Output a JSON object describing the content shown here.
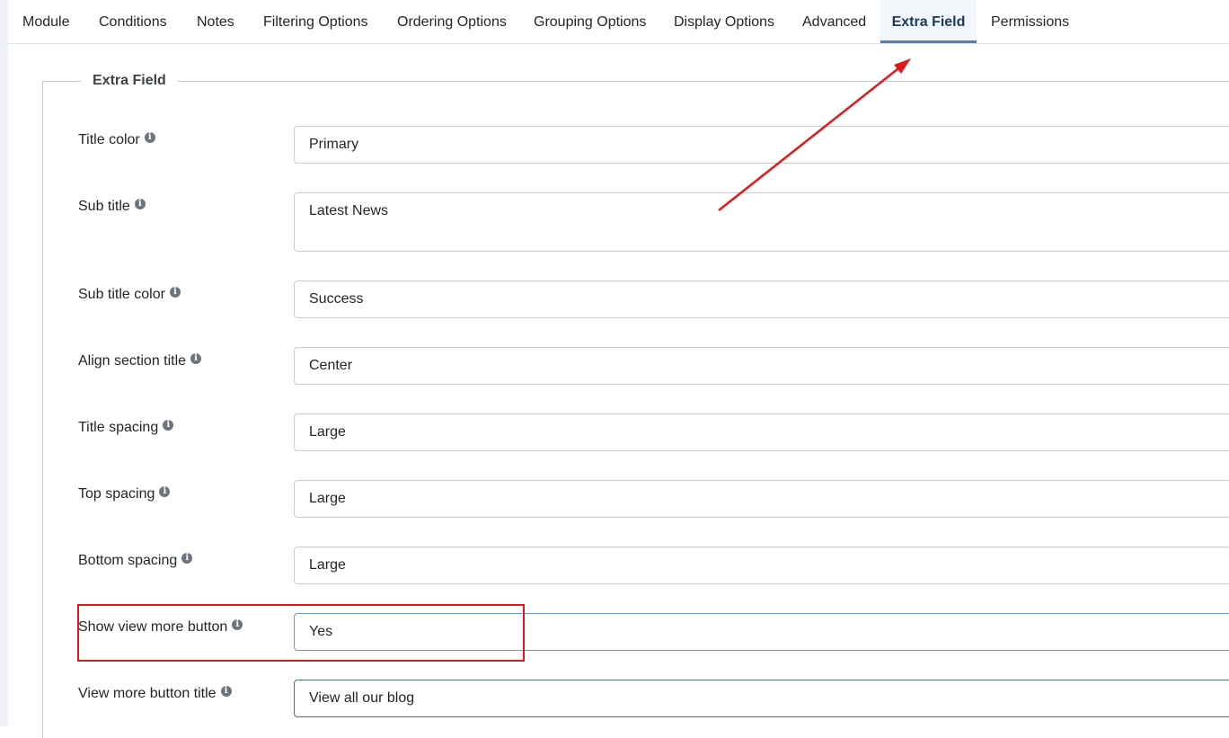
{
  "tabs": [
    {
      "label": "Module"
    },
    {
      "label": "Conditions"
    },
    {
      "label": "Notes"
    },
    {
      "label": "Filtering Options"
    },
    {
      "label": "Ordering Options"
    },
    {
      "label": "Grouping Options"
    },
    {
      "label": "Display Options"
    },
    {
      "label": "Advanced"
    },
    {
      "label": "Extra Field",
      "active": true
    },
    {
      "label": "Permissions"
    }
  ],
  "section": {
    "legend": "Extra Field",
    "fields": [
      {
        "label": "Title color",
        "value": "Primary"
      },
      {
        "label": "Sub title",
        "value": "Latest News"
      },
      {
        "label": "Sub title color",
        "value": "Success"
      },
      {
        "label": "Align section title",
        "value": "Center"
      },
      {
        "label": "Title spacing",
        "value": "Large"
      },
      {
        "label": "Top spacing",
        "value": "Large"
      },
      {
        "label": "Bottom spacing",
        "value": "Large"
      },
      {
        "label": "Show view more button",
        "value": "Yes"
      },
      {
        "label": "View more button title",
        "value": "View all our blog"
      }
    ]
  },
  "info_glyph": "i",
  "colors": {
    "active_tab_underline": "#4a82c0",
    "annotation_red": "#e01a1a"
  }
}
